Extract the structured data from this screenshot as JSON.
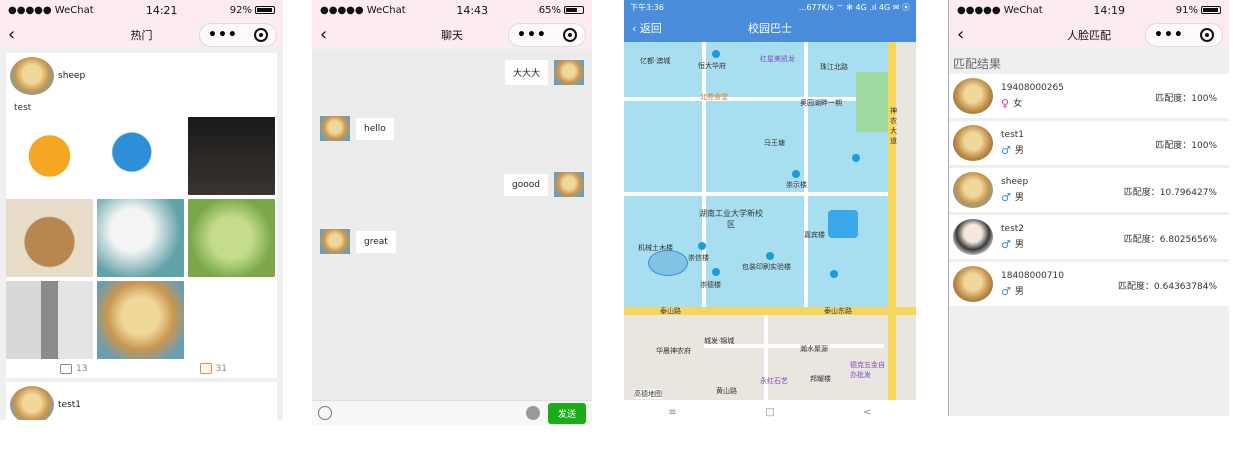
{
  "phone1": {
    "status": {
      "carrier": "●●●●● WeChat",
      "time": "14:21",
      "battery": "92%"
    },
    "title": "热门",
    "post1": {
      "user": "sheep",
      "text": "test",
      "comments": "13",
      "likes": "31"
    },
    "post2": {
      "user": "test1"
    }
  },
  "phone2": {
    "status": {
      "carrier": "●●●●● WeChat",
      "time": "14:43",
      "battery": "65%"
    },
    "title": "聊天",
    "messages": [
      {
        "side": "right",
        "text": "大大大"
      },
      {
        "side": "left",
        "text": "hello"
      },
      {
        "side": "right",
        "text": "goood"
      },
      {
        "side": "left",
        "text": "great"
      }
    ],
    "send_label": "发送"
  },
  "phone3": {
    "status": {
      "time": "下午3:36",
      "info": "...677K/s ⌔ ✻ 4G .ıl 4G ✉ ⦿"
    },
    "back_label": "返回",
    "title": "校园巴士",
    "map_labels": [
      {
        "text": "亿都·澳城"
      },
      {
        "text": "恒大华府"
      },
      {
        "text": "红星美凯龙"
      },
      {
        "text": "珠江北路"
      },
      {
        "text": "北苑食堂"
      },
      {
        "text": "奥园湖畔一期"
      },
      {
        "text": "马王塘"
      },
      {
        "text": "崇示楼"
      },
      {
        "text": "湖南工业大学新校区"
      },
      {
        "text": "机械土木楼"
      },
      {
        "text": "崇信楼"
      },
      {
        "text": "包装印刷实验楼"
      },
      {
        "text": "崇德楼"
      },
      {
        "text": "嘉宾楼"
      },
      {
        "text": "泰山路"
      },
      {
        "text": "泰山东路"
      },
      {
        "text": "城发·锦城"
      },
      {
        "text": "华晨神农府"
      },
      {
        "text": "瀚水聚源"
      },
      {
        "text": "德克五金自办批发"
      },
      {
        "text": "永红石艺"
      },
      {
        "text": "邦耀楼"
      },
      {
        "text": "黄山路"
      },
      {
        "text": "神农大道"
      },
      {
        "text": "高德地图"
      }
    ],
    "bottom_nav": [
      "≡",
      "□",
      "<"
    ]
  },
  "phone4": {
    "status": {
      "carrier": "●●●●● WeChat",
      "time": "14:19",
      "battery": "91%"
    },
    "title": "人脸匹配",
    "section_title": "匹配结果",
    "results": [
      {
        "name": "19408000265",
        "gender_symbol": "♀",
        "gender": "女",
        "score": "匹配度：100%"
      },
      {
        "name": "test1",
        "gender_symbol": "♂",
        "gender": "男",
        "score": "匹配度：100%"
      },
      {
        "name": "sheep",
        "gender_symbol": "♂",
        "gender": "男",
        "score": "匹配度：10.796427%"
      },
      {
        "name": "test2",
        "gender_symbol": "♂",
        "gender": "男",
        "score": "匹配度：6.8025656%"
      },
      {
        "name": "18408000710",
        "gender_symbol": "♂",
        "gender": "男",
        "score": "匹配度：0.64363784%"
      }
    ]
  }
}
